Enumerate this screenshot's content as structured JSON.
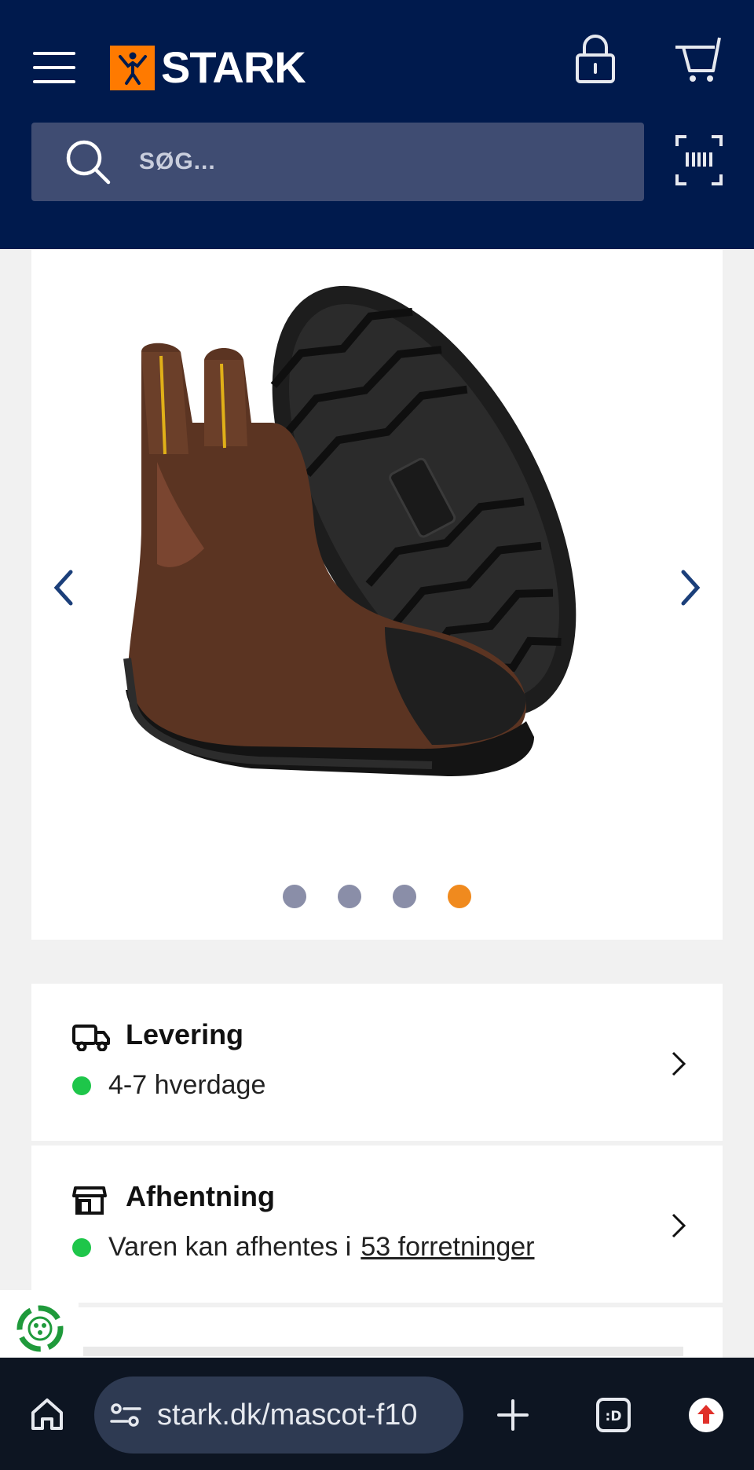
{
  "header": {
    "logo_text": "STARK",
    "brand_color": "#ff7a00",
    "background": "#001a4d"
  },
  "search": {
    "placeholder": "SØG..."
  },
  "gallery": {
    "image_alt": "Mascot brown leather Chelsea safety boot",
    "dots_count": 4,
    "active_dot": 4
  },
  "delivery": {
    "title": "Levering",
    "status": "4-7 hverdage",
    "status_color": "#1ec64a"
  },
  "pickup": {
    "title": "Afhentning",
    "status_prefix": "Varen kan afhentes i",
    "stores_link": "53 forretninger",
    "status_color": "#1ec64a"
  },
  "browser": {
    "url": "stark.dk/mascot-f10"
  }
}
